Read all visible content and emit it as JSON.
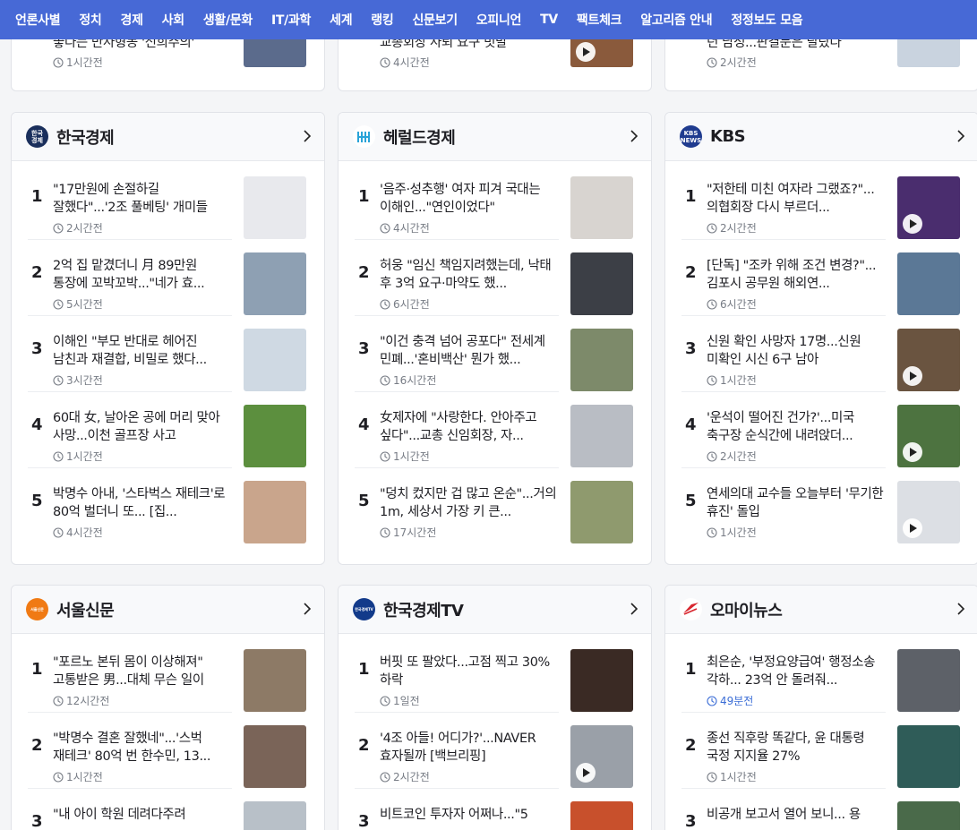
{
  "nav": [
    {
      "label": "언론사별"
    },
    {
      "label": "정치"
    },
    {
      "label": "경제"
    },
    {
      "label": "사회"
    },
    {
      "label": "생활/문화"
    },
    {
      "label": "IT/과학"
    },
    {
      "label": "세계"
    },
    {
      "label": "랭킹"
    },
    {
      "label": "신문보기"
    },
    {
      "label": "오피니언"
    },
    {
      "label": "TV"
    },
    {
      "label": "팩트체크"
    },
    {
      "label": "알고리즘 안내"
    },
    {
      "label": "정정보도 모음"
    }
  ],
  "top_partial": [
    {
      "title": "좋다는 반사형동 '신희주의'",
      "time": "1시간전",
      "thumb_color": "#5b6b8c"
    },
    {
      "title": "교총회장 사퇴 요구 빗발",
      "time": "4시간전",
      "thumb_color": "#8a5a3c"
    },
    {
      "title": "던 남성...판결문은 달랐다",
      "time": "2시간전",
      "thumb_color": "#c9d3df"
    }
  ],
  "cards": [
    {
      "press": "한국경제",
      "logo_text": "한국\n경제",
      "logo_color": "#1a2f5c",
      "items": [
        {
          "rank": "1",
          "title": "\"17만원에 손절하길 잘했다\"...'2조 풀베팅' 개미들 경...",
          "time": "2시간전",
          "thumb_color": "#e8e9ed",
          "video": false
        },
        {
          "rank": "2",
          "title": "2억 집 맡겼더니 月 89만원 통장에 꼬박꼬박...\"네가 효...",
          "time": "5시간전",
          "thumb_color": "#8ea0b3",
          "video": false
        },
        {
          "rank": "3",
          "title": "이해인 \"부모 반대로 헤어진 남친과 재결합, 비밀로 했다...",
          "time": "3시간전",
          "thumb_color": "#cfd9e3",
          "video": false
        },
        {
          "rank": "4",
          "title": "60대 女, 날아온 공에 머리 맞아 사망...이천 골프장 사고",
          "time": "1시간전",
          "thumb_color": "#5c8f3e",
          "video": false
        },
        {
          "rank": "5",
          "title": "박명수 아내, '스타벅스 재테크'로 80억 벌더니 또... [집...",
          "time": "4시간전",
          "thumb_color": "#c9a58c",
          "video": false
        }
      ]
    },
    {
      "press": "헤럴드경제",
      "logo_text": "",
      "logo_color": "#ffffff",
      "items": [
        {
          "rank": "1",
          "title": "'음주·성추행' 여자 피겨 국대는 이해인...\"연인이었다\"",
          "time": "4시간전",
          "thumb_color": "#d8d4d0",
          "video": false
        },
        {
          "rank": "2",
          "title": "허웅 \"임신 책임지려했는데, 낙태 후 3억 요구·마약도 했...",
          "time": "6시간전",
          "thumb_color": "#3c3f46",
          "video": false
        },
        {
          "rank": "3",
          "title": "\"이건 충격 넘어 공포다\" 전세계 민폐...'혼비백산' 뭔가 했...",
          "time": "16시간전",
          "thumb_color": "#7d8a6a",
          "video": false
        },
        {
          "rank": "4",
          "title": "女제자에 \"사랑한다. 안아주고 싶다\"...교총 신임회장, 자...",
          "time": "1시간전",
          "thumb_color": "#b9bdc4",
          "video": false
        },
        {
          "rank": "5",
          "title": "\"덩치 컸지만 겁 많고 온순\"...거의 1m, 세상서 가장 키 큰...",
          "time": "17시간전",
          "thumb_color": "#8f9a6e",
          "video": false
        }
      ]
    },
    {
      "press": "KBS",
      "logo_text": "KBS\nNEWS",
      "logo_color": "#1f3b8f",
      "items": [
        {
          "rank": "1",
          "title": "\"저한테 미친 여자라 그랬죠?\"...의협회장 다시 부르더...",
          "time": "2시간전",
          "thumb_color": "#4a2d6e",
          "video": true
        },
        {
          "rank": "2",
          "title": "[단독] \"조카 위해 조건 변경?\"...김포시 공무원 해외연...",
          "time": "6시간전",
          "thumb_color": "#5b7896",
          "video": false
        },
        {
          "rank": "3",
          "title": "신원 확인 사망자 17명...신원 미확인 시신 6구 남아",
          "time": "1시간전",
          "thumb_color": "#6a5440",
          "video": true
        },
        {
          "rank": "4",
          "title": "'운석이 떨어진 건가?'...미국 축구장 순식간에 내려앉더...",
          "time": "2시간전",
          "thumb_color": "#4d7340",
          "video": true
        },
        {
          "rank": "5",
          "title": "연세의대 교수들 오늘부터 '무기한 휴진' 돌입",
          "time": "1시간전",
          "thumb_color": "#dcdfe4",
          "video": true
        }
      ]
    },
    {
      "press": "서울신문",
      "logo_text": "서울신문",
      "logo_color": "#f07a14",
      "items": [
        {
          "rank": "1",
          "title": "\"포르노 본뒤 몸이 이상해져\" 고통받은 男...대체 무슨 일이",
          "time": "12시간전",
          "thumb_color": "#8d7a66",
          "video": false
        },
        {
          "rank": "2",
          "title": "\"박명수 결혼 잘했네\"...'스벅 재테크' 80억 번 한수민, 13...",
          "time": "1시간전",
          "thumb_color": "#7a6458",
          "video": false
        },
        {
          "rank": "3",
          "title": "\"내 아이 학원 데려다주려",
          "time": "",
          "thumb_color": "#b8c0c8",
          "video": false
        }
      ]
    },
    {
      "press": "한국경제TV",
      "logo_text": "한국경제TV",
      "logo_color": "#123a8a",
      "items": [
        {
          "rank": "1",
          "title": "버핏 또 팔았다...고점 찍고 30% 하락",
          "time": "1일전",
          "thumb_color": "#3a2a24",
          "video": false
        },
        {
          "rank": "2",
          "title": "'4조 아들! 어디가?'...NAVER 효자될까 [백브리핑]",
          "time": "2시간전",
          "thumb_color": "#9aa0a8",
          "video": true
        },
        {
          "rank": "3",
          "title": "비트코인 투자자 어쩌나...\"5",
          "time": "",
          "thumb_color": "#c8502c",
          "video": false
        }
      ]
    },
    {
      "press": "오마이뉴스",
      "logo_text": "",
      "logo_color": "#ffffff",
      "items": [
        {
          "rank": "1",
          "title": "최은순, '부정요양급여' 행정소송 각하... 23억 안 돌려줘...",
          "time": "49분전",
          "thumb_color": "#5d6168",
          "video": false,
          "fresh": true
        },
        {
          "rank": "2",
          "title": "종선 직후랑 똑같다, 윤 대통령 국정 지지율 27%",
          "time": "1시간전",
          "thumb_color": "#2f5c58",
          "video": false
        },
        {
          "rank": "3",
          "title": "비공개 보고서 열어 보니... 용",
          "time": "",
          "thumb_color": "#4a6a4a",
          "video": false
        }
      ]
    }
  ]
}
